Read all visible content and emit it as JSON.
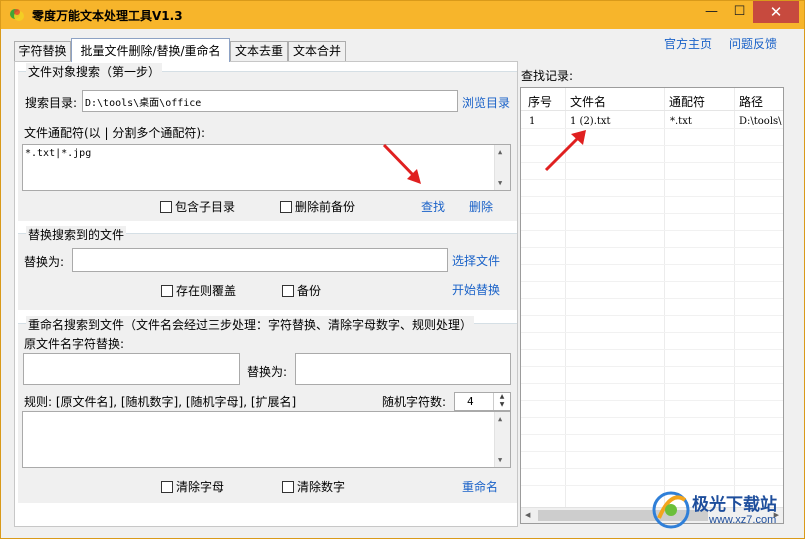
{
  "window": {
    "title": "零度万能文本处理工具V1.3",
    "min_glyph": "—",
    "max_glyph": "☐",
    "close_glyph": "✕"
  },
  "tabs": [
    {
      "label": "字符替换"
    },
    {
      "label": "批量文件删除/替换/重命名"
    },
    {
      "label": "文本去重"
    },
    {
      "label": "文本合并"
    }
  ],
  "top_links": {
    "home": "官方主页",
    "feedback": "问题反馈"
  },
  "search_group": {
    "legend": "文件对象搜索（第一步）",
    "dir_label": "搜索目录:",
    "dir_value": "D:\\tools\\桌面\\office",
    "browse": "浏览目录",
    "wildcard_label": "文件通配符(以 | 分割多个通配符):",
    "wildcard_value": "*.txt|*.jpg",
    "include_subdirs": "包含子目录",
    "backup_before_delete": "删除前备份",
    "find": "查找",
    "delete": "删除"
  },
  "replace_group": {
    "legend": "替换搜索到的文件",
    "replace_label": "替换为:",
    "replace_value": "",
    "select_file": "选择文件",
    "overwrite_if_exists": "存在则覆盖",
    "backup": "备份",
    "start_replace": "开始替换"
  },
  "rename_group": {
    "legend": "重命名搜索到文件（文件名会经过三步处理：字符替换、清除字母数字、规则处理）",
    "orig_label": "原文件名字符替换:",
    "replace_with_label": "替换为:",
    "rule_label": "规则: [原文件名], [随机数字], [随机字母], [扩展名]",
    "random_chars_label": "随机字符数:",
    "random_chars_value": "4",
    "clear_letters": "清除字母",
    "clear_digits": "清除数字",
    "rename": "重命名"
  },
  "results": {
    "label": "查找记录:",
    "headers": [
      "序号",
      "文件名",
      "通配符",
      "路径"
    ],
    "rows": [
      [
        "1",
        "1 (2).txt",
        "*.txt",
        "D:\\tools\\"
      ]
    ]
  },
  "watermark": {
    "name": "极光下载站",
    "url": "www.xz7.com"
  },
  "colors": {
    "titlebar": "#f7b52b",
    "link": "#1a62c8",
    "close": "#c74a3e",
    "arrow": "#e02020"
  }
}
